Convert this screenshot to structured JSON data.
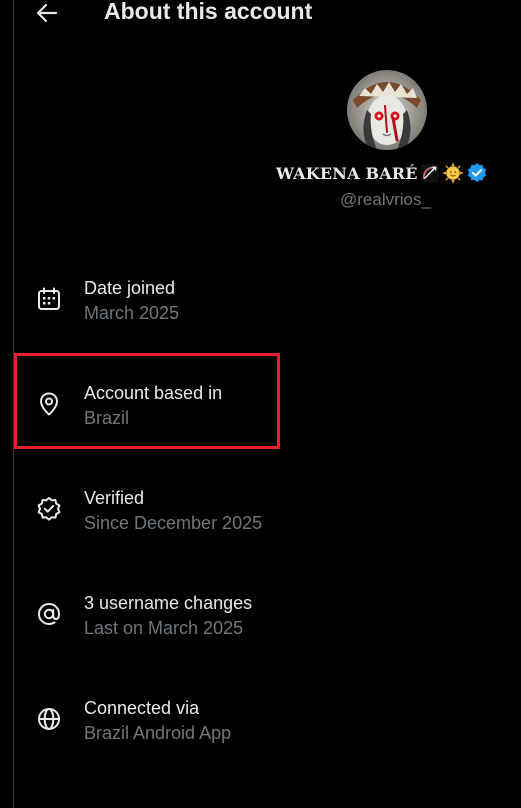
{
  "header": {
    "title": "About this account",
    "back_icon": "arrow-left-icon"
  },
  "profile": {
    "display_name": "WAKENA BARÉ",
    "name_emojis": [
      "bow-and-arrow-icon",
      "sun-with-face-icon"
    ],
    "verified_badge_color": "#1d9bf0",
    "handle": "@realvrios_"
  },
  "info_items": [
    {
      "icon": "calendar-icon",
      "label": "Date joined",
      "value": "March 2025"
    },
    {
      "icon": "location-pin-icon",
      "label": "Account based in",
      "value": "Brazil"
    },
    {
      "icon": "verified-check-icon",
      "label": "Verified",
      "value": "Since December 2025"
    },
    {
      "icon": "at-sign-icon",
      "label": "3 username changes",
      "value": "Last on March 2025"
    },
    {
      "icon": "globe-icon",
      "label": "Connected via",
      "value": "Brazil Android App"
    }
  ],
  "colors": {
    "background": "#000000",
    "primary_text": "#e7e9ea",
    "secondary_text": "#71767b",
    "highlight": "#e8202a"
  }
}
